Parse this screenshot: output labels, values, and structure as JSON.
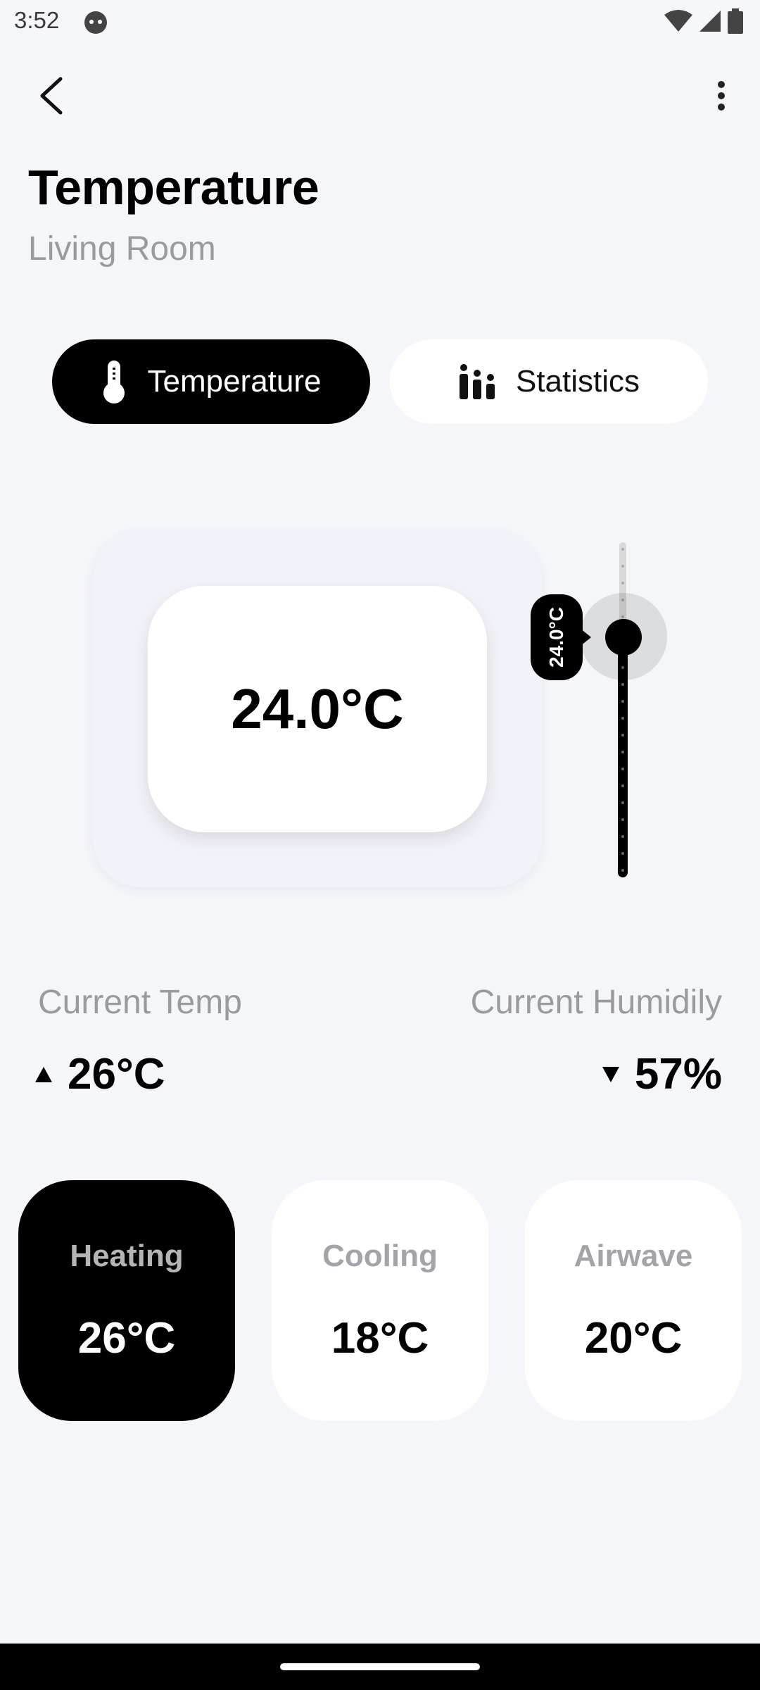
{
  "status_bar": {
    "time": "3:52"
  },
  "header": {
    "title": "Temperature",
    "subtitle": "Living Room"
  },
  "tabs": [
    {
      "label": "Temperature",
      "icon": "thermometer-icon",
      "active": true
    },
    {
      "label": "Statistics",
      "icon": "bar-chart-icon",
      "active": false
    }
  ],
  "thermostat": {
    "set_temp": "24.0°C",
    "slider_label": "24.0°C",
    "slider_level": 0.72
  },
  "readings": {
    "current_temp_label": "Current Temp",
    "current_temp_value": "26°C",
    "current_temp_trend": "up",
    "current_humidity_label": "Current Humidily",
    "current_humidity_value": "57%",
    "current_humidity_trend": "down"
  },
  "modes": [
    {
      "label": "Heating",
      "value": "26°C",
      "active": true
    },
    {
      "label": "Cooling",
      "value": "18°C",
      "active": false
    },
    {
      "label": "Airwave",
      "value": "20°C",
      "active": false
    }
  ],
  "colors": {
    "accent": "#000000",
    "background": "#f5f6fa",
    "muted_text": "#9a9ba1"
  }
}
